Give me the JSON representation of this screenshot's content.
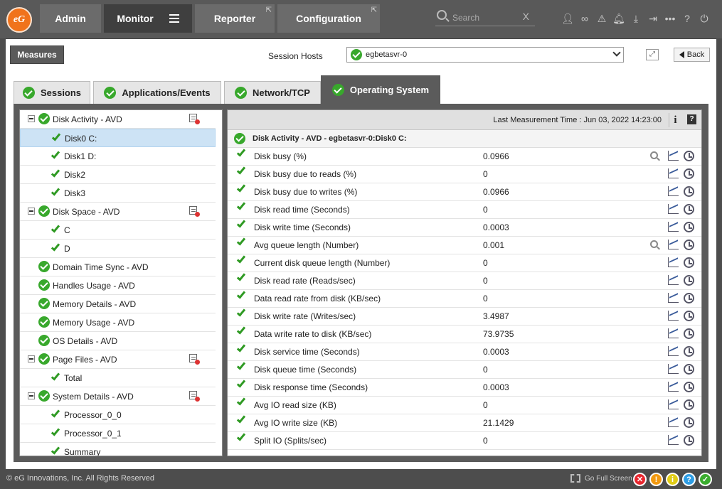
{
  "nav": {
    "logo_text": "eG",
    "tabs": [
      {
        "label": "Admin",
        "active": false,
        "external": false
      },
      {
        "label": "Monitor",
        "active": true,
        "external": false
      },
      {
        "label": "Reporter",
        "active": false,
        "external": true
      },
      {
        "label": "Configuration",
        "active": false,
        "external": true
      }
    ],
    "search_placeholder": "Search",
    "icons": [
      "user-icon",
      "link-icon",
      "alert-triangle-icon",
      "bell-icon",
      "download-icon",
      "sign-in-icon",
      "more-icon",
      "help-icon",
      "power-icon"
    ]
  },
  "toolbar": {
    "measures_label": "Measures",
    "session_hosts_label": "Session Hosts",
    "session_host_value": "egbetasvr-0",
    "back_label": "Back"
  },
  "tabs": [
    {
      "label": "Sessions",
      "active": false
    },
    {
      "label": "Applications/Events",
      "active": false
    },
    {
      "label": "Network/TCP",
      "active": false
    },
    {
      "label": "Operating System",
      "active": true
    }
  ],
  "tree": [
    {
      "label": "Disk Activity - AVD",
      "level": 0,
      "expandable": true,
      "has_action": true
    },
    {
      "label": "Disk0 C:",
      "level": 1,
      "selected": true
    },
    {
      "label": "Disk1 D:",
      "level": 1
    },
    {
      "label": "Disk2",
      "level": 1
    },
    {
      "label": "Disk3",
      "level": 1
    },
    {
      "label": "Disk Space - AVD",
      "level": 0,
      "expandable": true,
      "has_action": true
    },
    {
      "label": "C",
      "level": 1
    },
    {
      "label": "D",
      "level": 1
    },
    {
      "label": "Domain Time Sync - AVD",
      "level": 0
    },
    {
      "label": "Handles Usage - AVD",
      "level": 0
    },
    {
      "label": "Memory Details - AVD",
      "level": 0
    },
    {
      "label": "Memory Usage - AVD",
      "level": 0
    },
    {
      "label": "OS Details - AVD",
      "level": 0
    },
    {
      "label": "Page Files - AVD",
      "level": 0,
      "expandable": true,
      "has_action": true
    },
    {
      "label": "Total",
      "level": 1
    },
    {
      "label": "System Details - AVD",
      "level": 0,
      "expandable": true,
      "has_action": true
    },
    {
      "label": "Processor_0_0",
      "level": 1
    },
    {
      "label": "Processor_0_1",
      "level": 1
    },
    {
      "label": "Summary",
      "level": 1
    }
  ],
  "measures_panel": {
    "last_measurement": "Last Measurement Time : Jun 03, 2022 14:23:00",
    "info_label": "i",
    "help_label": "?",
    "test_title": "Disk Activity - AVD - egbetasvr-0:Disk0 C:",
    "rows": [
      {
        "name": "Disk busy (%)",
        "value": "0.0966",
        "detail": true
      },
      {
        "name": "Disk busy due to reads (%)",
        "value": "0"
      },
      {
        "name": "Disk busy due to writes (%)",
        "value": "0.0966"
      },
      {
        "name": "Disk read time (Seconds)",
        "value": "0"
      },
      {
        "name": "Disk write time (Seconds)",
        "value": "0.0003"
      },
      {
        "name": "Avg queue length (Number)",
        "value": "0.001",
        "detail": true
      },
      {
        "name": "Current disk queue length (Number)",
        "value": "0"
      },
      {
        "name": "Disk read rate (Reads/sec)",
        "value": "0"
      },
      {
        "name": "Data read rate from disk (KB/sec)",
        "value": "0"
      },
      {
        "name": "Disk write rate (Writes/sec)",
        "value": "3.4987"
      },
      {
        "name": "Data write rate to disk (KB/sec)",
        "value": "73.9735"
      },
      {
        "name": "Disk service time (Seconds)",
        "value": "0.0003"
      },
      {
        "name": "Disk queue time (Seconds)",
        "value": "0"
      },
      {
        "name": "Disk response time (Seconds)",
        "value": "0.0003"
      },
      {
        "name": "Avg IO read size (KB)",
        "value": "0"
      },
      {
        "name": "Avg IO write size (KB)",
        "value": "21.1429"
      },
      {
        "name": "Split IO (Splits/sec)",
        "value": "0"
      }
    ]
  },
  "footer": {
    "copyright": "© eG Innovations, Inc. All Rights Reserved",
    "fullscreen_label": "Go Full Screen",
    "status_dots": [
      {
        "name": "critical",
        "color": "#e8262e",
        "glyph": "✕"
      },
      {
        "name": "major",
        "color": "#f29a11",
        "glyph": "!"
      },
      {
        "name": "minor",
        "color": "#e1cd18",
        "glyph": "i"
      },
      {
        "name": "unknown",
        "color": "#2e9de4",
        "glyph": "?"
      },
      {
        "name": "normal",
        "color": "#3bad2f",
        "glyph": "✓"
      }
    ]
  }
}
